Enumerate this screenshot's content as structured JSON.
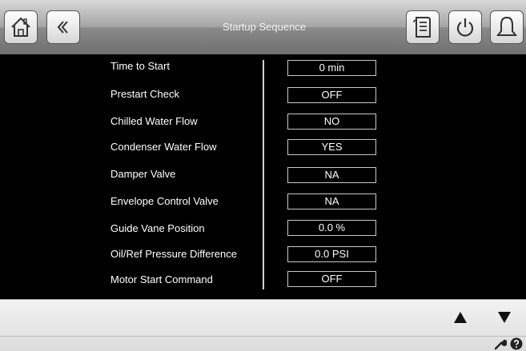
{
  "header": {
    "title": "Startup Sequence",
    "buttons": [
      {
        "name": "home",
        "icon": "home-icon"
      },
      {
        "name": "back",
        "icon": "back-chevron-icon"
      },
      {
        "name": "log",
        "icon": "log-icon"
      },
      {
        "name": "power",
        "icon": "power-icon"
      },
      {
        "name": "alarm",
        "icon": "bell-icon"
      }
    ]
  },
  "rows": [
    {
      "label": "Time to Start",
      "value": "0 min"
    },
    {
      "label": "Prestart Check",
      "value": "OFF"
    },
    {
      "label": "Chilled Water Flow",
      "value": "NO"
    },
    {
      "label": "Condenser Water Flow",
      "value": "YES"
    },
    {
      "label": "Damper Valve",
      "value": "NA"
    },
    {
      "label": "Envelope Control Valve",
      "value": "NA"
    },
    {
      "label": "Guide Vane Position",
      "value": "0.0 %"
    },
    {
      "label": "Oil/Ref Pressure Difference",
      "value": "0.0 PSI"
    },
    {
      "label": "Motor Start Command",
      "value": "OFF"
    }
  ],
  "footer": {
    "up_icon": "up-arrow-icon",
    "down_icon": "down-arrow-icon",
    "tools": [
      "wrench-icon",
      "help-icon"
    ]
  }
}
